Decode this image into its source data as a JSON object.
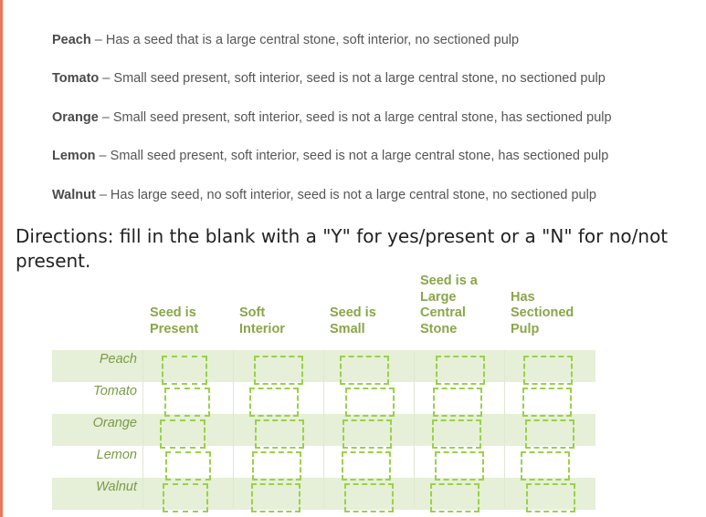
{
  "descriptions": [
    {
      "fruit": "Peach",
      "text": " – Has a seed that is a large central stone, soft interior, no sectioned pulp"
    },
    {
      "fruit": "Tomato",
      "text": " – Small seed present, soft interior, seed is not a large central stone, no sectioned pulp"
    },
    {
      "fruit": "Orange",
      "text": " – Small seed present, soft interior, seed is not a large central stone, has sectioned pulp"
    },
    {
      "fruit": "Lemon",
      "text": " – Small seed present, soft interior, seed is not a large central stone, has sectioned pulp"
    },
    {
      "fruit": "Walnut",
      "text": " – Has large seed, no soft interior, seed is not a large central stone, no sectioned pulp"
    }
  ],
  "directions": "Directions: fill in the blank with a \"Y\" for yes/present or a \"N\" for no/not present.",
  "table": {
    "columns": [
      [
        "Seed is",
        "Present"
      ],
      [
        "Soft",
        "Interior"
      ],
      [
        "Seed is",
        "Small"
      ],
      [
        "Seed is a",
        "Large",
        "Central",
        "Stone"
      ],
      [
        "Has",
        "Sectioned",
        "Pulp"
      ]
    ],
    "rows": [
      "Peach",
      "Tomato",
      "Orange",
      "Lemon",
      "Walnut"
    ]
  },
  "colors": {
    "accent_border": "#e8785a",
    "header_green": "#8aa54a",
    "row_shade": "#e6efd8",
    "box_dash": "#9bd04a"
  }
}
